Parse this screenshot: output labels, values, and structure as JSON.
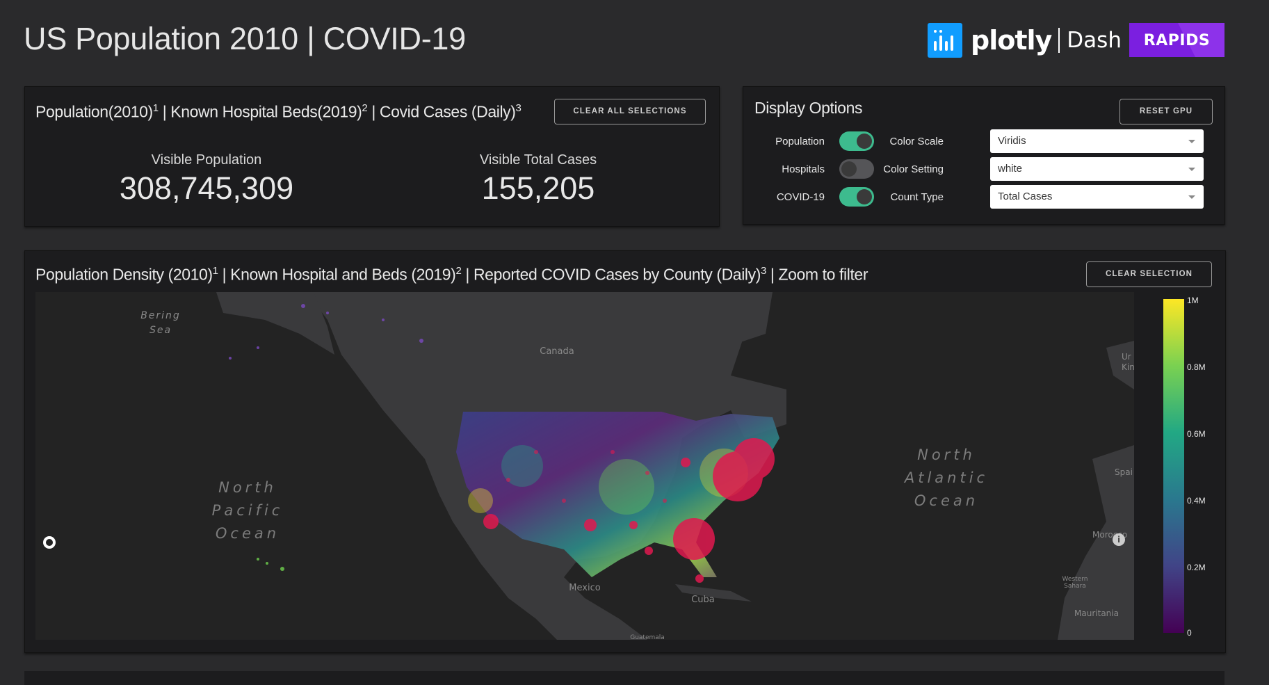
{
  "header": {
    "title": "US Population 2010 | COVID-19"
  },
  "logos": {
    "plotly": "plotly",
    "dash": "Dash",
    "rapids": "RAPIDS"
  },
  "stats_panel": {
    "title": "Population(2010)",
    "title_sup1": "1",
    "title_mid1": " | Known Hospital Beds(2019)",
    "title_sup2": "2",
    "title_mid2": " | Covid Cases (Daily)",
    "title_sup3": "3",
    "clear_all_label": "CLEAR ALL SELECTIONS",
    "visible_population_label": "Visible Population",
    "visible_population_value": "308,745,309",
    "visible_cases_label": "Visible Total Cases",
    "visible_cases_value": "155,205"
  },
  "options_panel": {
    "title": "Display Options",
    "reset_label": "RESET GPU",
    "toggles": [
      {
        "label": "Population",
        "on": true
      },
      {
        "label": "Hospitals",
        "on": false
      },
      {
        "label": "COVID-19",
        "on": true
      }
    ],
    "selects": [
      {
        "label": "Color Scale",
        "value": "Viridis"
      },
      {
        "label": "Color Setting",
        "value": "white"
      },
      {
        "label": "Count Type",
        "value": "Total Cases"
      }
    ]
  },
  "map_panel": {
    "title_a": "Population Density (2010)",
    "sup1": "1",
    "title_b": " | Known Hospital and Beds (2019)",
    "sup2": "2",
    "title_c": " | Reported COVID Cases by County (Daily)",
    "sup3": "3",
    "title_d": " | Zoom to filter",
    "clear_label": "CLEAR SELECTION",
    "labels": {
      "bering_1": "Bering",
      "bering_2": "Sea",
      "canada": "Canada",
      "npo_1": "North",
      "npo_2": "Pacific",
      "npo_3": "Ocean",
      "nao_1": "North",
      "nao_2": "Atlantic",
      "nao_3": "Ocean",
      "mexico": "Mexico",
      "cuba": "Cuba",
      "morocco": "Morocco",
      "western_sahara_1": "Western",
      "western_sahara_2": "Sahara",
      "mauritania": "Mauritania",
      "spain": "Spai",
      "uk_1": "Ur",
      "uk_2": "King",
      "guatemala": "Guatemala"
    },
    "colorbar_ticks": [
      "1M",
      "0.8M",
      "0.6M",
      "0.4M",
      "0.2M",
      "0"
    ],
    "colors": {
      "scale_low": "#440154",
      "scale_high": "#fde725",
      "covid": "#e0194f"
    }
  }
}
